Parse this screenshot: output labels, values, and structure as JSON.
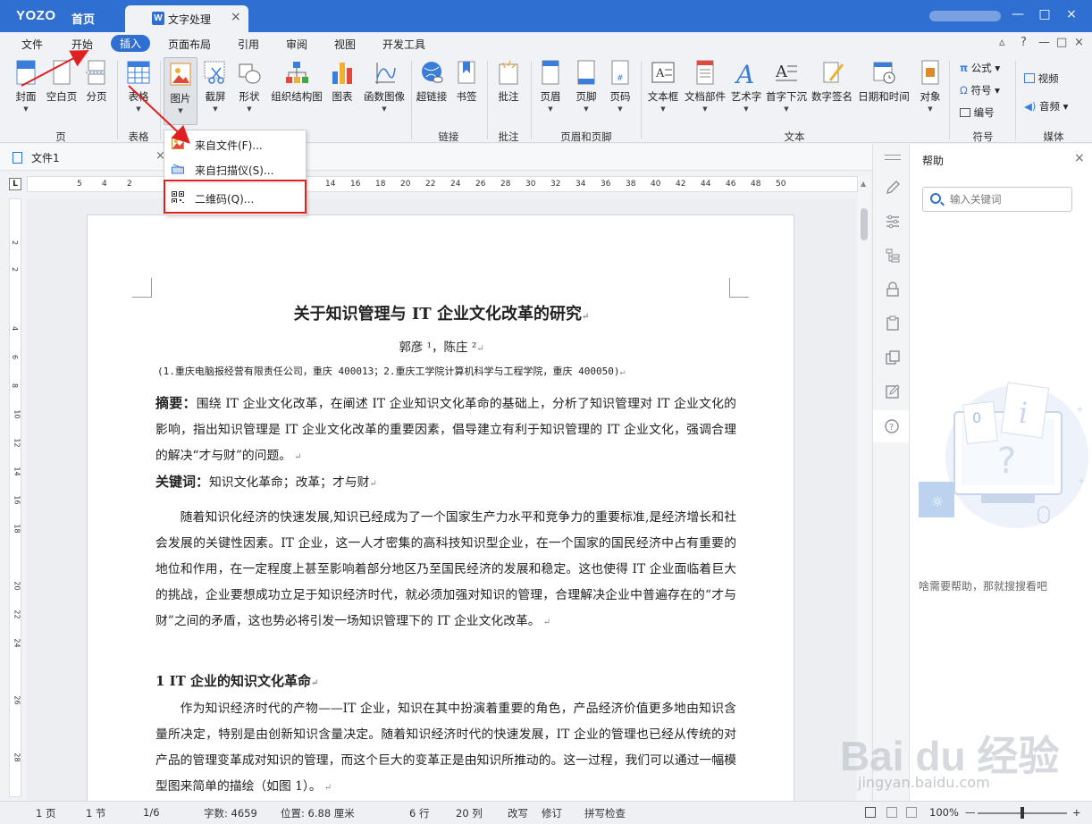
{
  "titlebar": {
    "logo": "YOZO",
    "home": "首页",
    "doc_tab_icon": "W",
    "doc_tab_label": "文字处理",
    "doc_tab_close": "×",
    "controls": [
      "—",
      "□",
      "×"
    ]
  },
  "menubar": {
    "items": [
      "文件",
      "开始",
      "插入",
      "页面布局",
      "引用",
      "审阅",
      "视图",
      "开发工具"
    ],
    "active": "插入",
    "right": [
      "?",
      "—",
      "□",
      "×"
    ]
  },
  "ribbon": {
    "buttons": {
      "cover": "封面",
      "blank_page": "空白页",
      "page_break": "分页",
      "table": "表格",
      "picture": "图片",
      "screenshot": "截屏",
      "shape": "形状",
      "org_chart": "组织结构图",
      "chart": "图表",
      "func_graph": "函数图像",
      "hyperlink": "超链接",
      "bookmark": "书签",
      "comment": "批注",
      "header": "页眉",
      "footer": "页脚",
      "page_number": "页码",
      "textbox": "文本框",
      "doc_part": "文档部件",
      "wordart": "艺术字",
      "drop_cap": "首字下沉",
      "digital_sig": "数字签名",
      "datetime": "日期和时间",
      "object": "对象",
      "formula": "公式",
      "symbol": "符号",
      "numbering": "编号",
      "video": "视频",
      "audio": "音频"
    },
    "groups": {
      "page": "页",
      "table": "表格",
      "link": "链接",
      "comment": "批注",
      "header_footer": "页眉和页脚",
      "text": "文本",
      "symbol": "符号",
      "media": "媒体"
    }
  },
  "dropdown": {
    "items": [
      "来自文件(F)...",
      "来自扫描仪(S)...",
      "二维码(Q)..."
    ],
    "highlighted": "二维码(Q)..."
  },
  "doctabs": {
    "file": "文件1",
    "close": "×"
  },
  "ruler": {
    "top": [
      "5",
      "4",
      "2",
      "14",
      "16",
      "18",
      "20",
      "22",
      "24",
      "26",
      "28",
      "30",
      "32",
      "34",
      "36",
      "38",
      "40",
      "42",
      "44",
      "46",
      "48",
      "50"
    ],
    "left": [
      "2",
      "2",
      "4",
      "6",
      "8",
      "10",
      "12",
      "14",
      "16",
      "18",
      "20",
      "22",
      "24",
      "26",
      "28"
    ],
    "corner": "L"
  },
  "document": {
    "title": "关于知识管理与 IT 企业文化改革的研究",
    "authors": "郭彦 ¹，陈庄 ²",
    "affiliation": "(1.重庆电脑报经营有限责任公司，重庆 400013；2.重庆工学院计算机科学与工程学院，重庆 400050)",
    "abstract_label": "摘要：",
    "abstract": "围绕 IT 企业文化改革，在阐述 IT 企业知识文化革命的基础上，分析了知识管理对 IT 企业文化的影响，指出知识管理是 IT 企业文化改革的重要因素，倡导建立有利于知识管理的 IT 企业文化，强调合理的解决“才与财”的问题。",
    "keywords_label": "关键词：",
    "keywords": "知识文化革命；改革；才与财",
    "para1": "随着知识化经济的快速发展,知识已经成为了一个国家生产力水平和竞争力的重要标准,是经济增长和社会发展的关键性因素。IT 企业，这一人才密集的高科技知识型企业，在一个国家的国民经济中占有重要的地位和作用，在一定程度上甚至影响着部分地区乃至国民经济的发展和稳定。这也使得 IT 企业面临着巨大的挑战，企业要想成功立足于知识经济时代，就必须加强对知识的管理，合理解决企业中普遍存在的“才与财”之间的矛盾，这也势必将引发一场知识管理下的 IT 企业文化改革。",
    "heading1": "1 IT 企业的知识文化革命",
    "para2": "作为知识经济时代的产物——IT 企业，知识在其中扮演着重要的角色，产品经济价值更多地由知识含量所决定，特别是由创新知识含量决定。随着知识经济时代的快速发展，IT 企业的管理也已经从传统的对产品的管理变革成对知识的管理，而这个巨大的变革正是由知识所推动的。这一过程，我们可以通过一幅模型图来简单的描绘（如图 1）。"
  },
  "help": {
    "title": "帮助",
    "close": "×",
    "search_placeholder": "输入关键词",
    "hint": "啥需要帮助，那就搜搜看吧"
  },
  "statusbar": {
    "page": "1 页",
    "section": "1 节",
    "page_of": "1/6",
    "word_count": "字数: 4659",
    "position": "位置: 6.88 厘米",
    "line": "6 行",
    "column": "20 列",
    "overwrite": "改写",
    "revise": "修订",
    "spellcheck": "拼写检查",
    "zoom": "100%",
    "zoom_minus": "—",
    "zoom_plus": "+"
  },
  "watermark": {
    "brand": "Bai du 经验",
    "url": "jingyan.baidu.com"
  },
  "colors": {
    "accent": "#2f6fd1",
    "annotation": "#e02020"
  }
}
